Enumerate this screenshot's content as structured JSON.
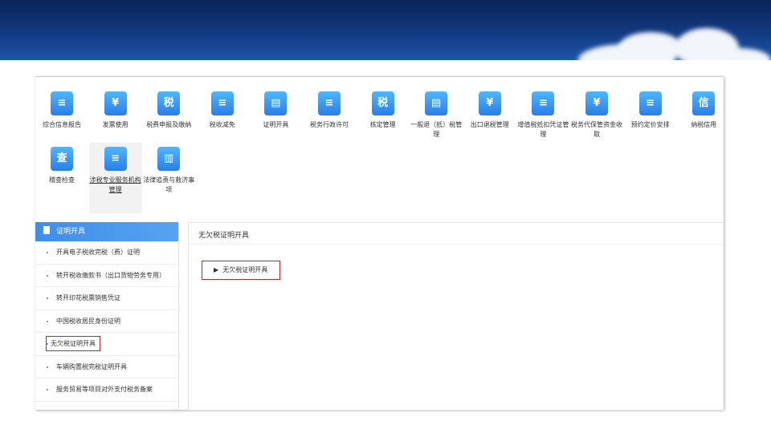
{
  "top_menu": [
    {
      "label": "综合信息报告",
      "glyph": "≡"
    },
    {
      "label": "发票使用",
      "glyph": "¥"
    },
    {
      "label": "税费申报及缴纳",
      "glyph": "税"
    },
    {
      "label": "税收减免",
      "glyph": "≡"
    },
    {
      "label": "证明开具",
      "glyph": "▤"
    },
    {
      "label": "税务行政许可",
      "glyph": "≡"
    },
    {
      "label": "核定管理",
      "glyph": "税"
    },
    {
      "label": "一般退（抵）税管理",
      "glyph": "▤"
    },
    {
      "label": "出口退税管理",
      "glyph": "¥"
    },
    {
      "label": "增值税抵扣凭证管理",
      "glyph": "≡"
    },
    {
      "label": "税务代保管资金收取",
      "glyph": "¥"
    },
    {
      "label": "预约定价安排",
      "glyph": "≡"
    },
    {
      "label": "纳税信用",
      "glyph": "信"
    },
    {
      "label": "稽查检查",
      "glyph": "查"
    },
    {
      "label": "涉税专业服务机构管理",
      "glyph": "≡"
    },
    {
      "label": "法律追责与救济事项",
      "glyph": "▥"
    }
  ],
  "selected_menu": "涉税专业服务机构管理",
  "sidebar": {
    "title": "证明开具",
    "items": [
      "开具电子税收完税（费）证明",
      "转开税收缴款书（出口货物劳务专用）",
      "转开印花税票销售凭证",
      "中国税收居民身份证明",
      "无欠税证明开具",
      "车辆购置税完税证明开具",
      "服务贸易等项目对外支付税务备案"
    ],
    "highlighted": "无欠税证明开具"
  },
  "main": {
    "title": "无欠税证明开具",
    "button_label": "无欠税证明开具",
    "button_icon": "triangle-right-icon"
  },
  "colors": {
    "accent": "#3f8ee8",
    "highlight_border": "#c0282d",
    "banner": "#123a82"
  }
}
